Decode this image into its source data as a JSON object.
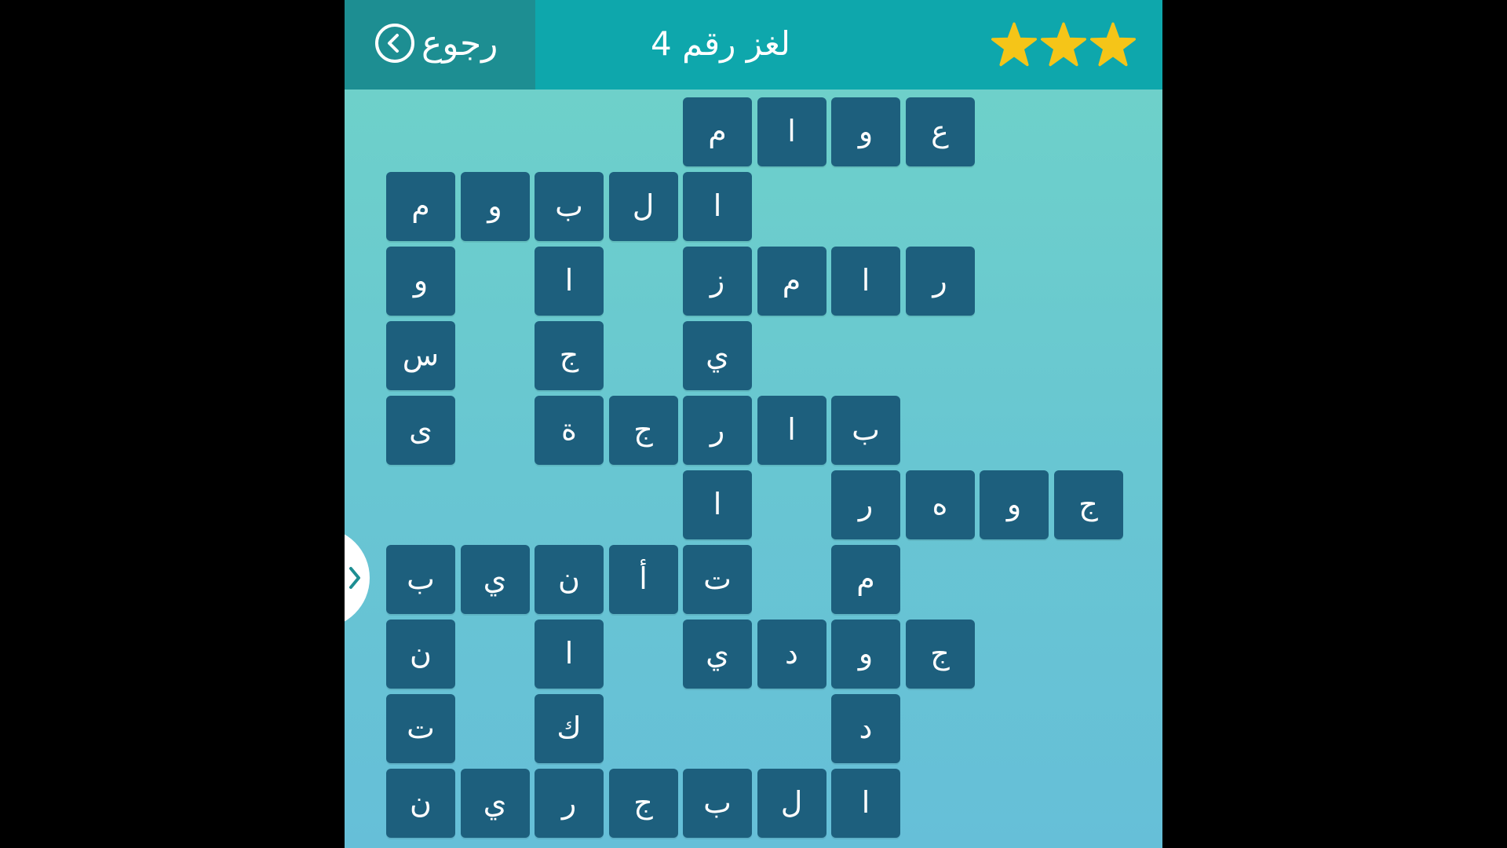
{
  "header": {
    "back_label": "رجوع",
    "title": "لغز رقم 4",
    "stars": 3,
    "star_color": "#f5c518"
  },
  "colors": {
    "header_bg": "#0ea7ac",
    "back_panel_bg": "#1d8e92",
    "tile_bg": "#1d5f7d",
    "page_bg_top": "#6fd3c8",
    "page_bg_bottom": "#66bfd8"
  },
  "icons": {
    "back": "chevron-left-circle-icon",
    "side_handle": "chevron-right-icon",
    "star": "star-icon"
  },
  "grid": {
    "rows": [
      [
        "",
        "",
        "",
        "",
        "م",
        "ا",
        "و",
        "ع",
        "",
        ""
      ],
      [
        "م",
        "و",
        "ب",
        "ل",
        "ا",
        "",
        "",
        "",
        "",
        ""
      ],
      [
        "و",
        "",
        "ا",
        "",
        "ز",
        "م",
        "ا",
        "ر",
        "",
        ""
      ],
      [
        "س",
        "",
        "ج",
        "",
        "ي",
        "",
        "",
        "",
        "",
        ""
      ],
      [
        "ى",
        "",
        "ة",
        "ج",
        "ر",
        "ا",
        "ب",
        "",
        "",
        ""
      ],
      [
        "",
        "",
        "",
        "",
        "ا",
        "",
        "ر",
        "ه",
        "و",
        "ج"
      ],
      [
        "ب",
        "ي",
        "ن",
        "أ",
        "ت",
        "",
        "م",
        "",
        "",
        ""
      ],
      [
        "ن",
        "",
        "ا",
        "",
        "ي",
        "د",
        "و",
        "ج",
        "",
        ""
      ],
      [
        "ت",
        "",
        "ك",
        "",
        "",
        "",
        "د",
        "",
        "",
        ""
      ],
      [
        "ن",
        "ي",
        "ر",
        "ج",
        "ب",
        "ل",
        "ا",
        "",
        "",
        ""
      ]
    ]
  }
}
